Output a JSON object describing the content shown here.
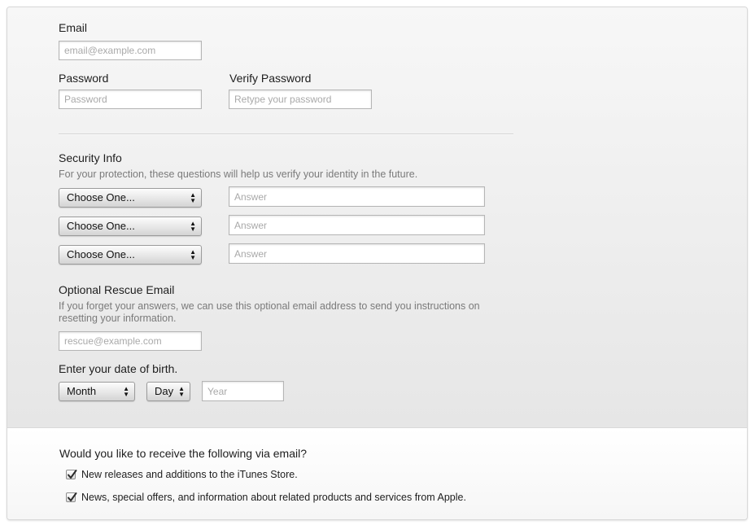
{
  "account": {
    "email_label": "Email",
    "email_placeholder": "email@example.com",
    "password_label": "Password",
    "password_placeholder": "Password",
    "verify_label": "Verify Password",
    "verify_placeholder": "Retype your password"
  },
  "security": {
    "title": "Security Info",
    "help": "For your protection, these questions will help us verify your identity in the future.",
    "questions": [
      {
        "select": "Choose One...",
        "answer_placeholder": "Answer"
      },
      {
        "select": "Choose One...",
        "answer_placeholder": "Answer"
      },
      {
        "select": "Choose One...",
        "answer_placeholder": "Answer"
      }
    ]
  },
  "rescue": {
    "title": "Optional Rescue Email",
    "help": "If you forget your answers, we can use this optional email address to send you instructions on resetting your information.",
    "placeholder": "rescue@example.com"
  },
  "dob": {
    "title": "Enter your date of birth.",
    "month": "Month",
    "day": "Day",
    "year_placeholder": "Year"
  },
  "newsletter": {
    "question": "Would you like to receive the following via email?",
    "options": [
      {
        "label": "New releases and additions to the iTunes Store.",
        "checked": true
      },
      {
        "label": "News, special offers, and information about related products and services from Apple.",
        "checked": true
      }
    ]
  },
  "icons": {
    "select_arrows": "up-down-arrows-icon",
    "check": "checkmark-icon"
  }
}
